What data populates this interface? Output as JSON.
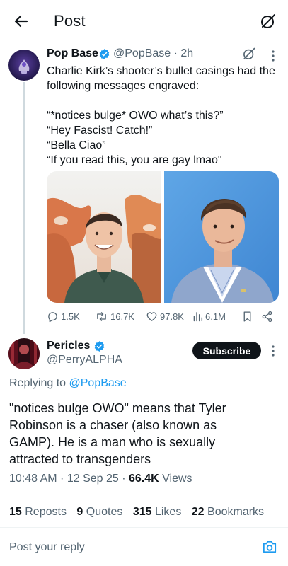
{
  "header": {
    "title": "Post"
  },
  "tweet": {
    "author_name": "Pop Base",
    "handle": "@PopBase",
    "time": "2h",
    "text_lines": [
      "Charlie Kirk’s shooter’s bullet casings had the",
      "following messages engraved:",
      "",
      "“*notices bulge* OWO what’s this?”",
      "“Hey Fascist! Catch!”",
      "“Bella Ciao”",
      "“If you read this, you are gay lmao\""
    ],
    "actions": {
      "replies": "1.5K",
      "reposts": "16.7K",
      "likes": "97.8K",
      "views": "6.1M"
    }
  },
  "reply": {
    "author_name": "Pericles",
    "handle": "@PerryALPHA",
    "subscribe_label": "Subscribe",
    "replying_prefix": "Replying to",
    "replying_handle": "@PopBase",
    "body_lines": [
      "\"notices bulge OWO\" means that Tyler",
      "Robinson is a chaser (also known as",
      "GAMP). He is a man who is sexually",
      "attracted to transgenders"
    ],
    "timestamp": "10:48 AM · 12 Sep 25 · ",
    "views_count": "66.4K",
    "views_label": "Views"
  },
  "stats": {
    "reposts_count": "15",
    "reposts_label": "Reposts",
    "quotes_count": "9",
    "quotes_label": "Quotes",
    "likes_count": "315",
    "likes_label": "Likes",
    "bookmarks_count": "22",
    "bookmarks_label": "Bookmarks"
  },
  "composer": {
    "placeholder": "Post your reply"
  },
  "colors": {
    "accent": "#1d9bf0",
    "text": "#0f1419",
    "secondary": "#536471",
    "divider": "#eff3f4"
  }
}
